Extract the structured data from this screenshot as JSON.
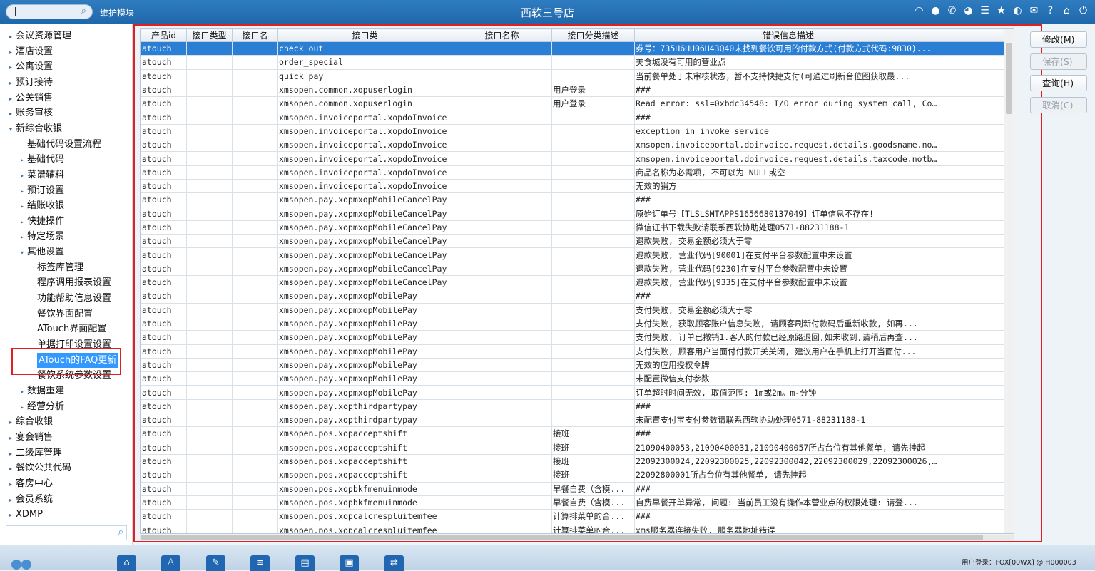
{
  "topbar": {
    "module": "维护模块",
    "title": "西软三号店",
    "icons": [
      "wifi-icon",
      "chat-icon",
      "phone-icon",
      "palette-icon",
      "menu-icon",
      "star-icon",
      "theme-icon",
      "mail-icon",
      "help-icon",
      "home-icon",
      "power-icon"
    ]
  },
  "sidebar": {
    "items": [
      {
        "label": "会议资源管理",
        "level": 0,
        "arrow": "▸"
      },
      {
        "label": "酒店设置",
        "level": 0,
        "arrow": "▸"
      },
      {
        "label": "公寓设置",
        "level": 0,
        "arrow": "▸"
      },
      {
        "label": "预订接待",
        "level": 0,
        "arrow": "▸"
      },
      {
        "label": "公关销售",
        "level": 0,
        "arrow": "▸"
      },
      {
        "label": "账务审核",
        "level": 0,
        "arrow": "▸"
      },
      {
        "label": "新综合收银",
        "level": 0,
        "arrow": "▾"
      },
      {
        "label": "基础代码设置流程",
        "level": 1,
        "arrow": ""
      },
      {
        "label": "基础代码",
        "level": 1,
        "arrow": "▸"
      },
      {
        "label": "菜谱辅料",
        "level": 1,
        "arrow": "▸"
      },
      {
        "label": "预订设置",
        "level": 1,
        "arrow": "▸"
      },
      {
        "label": "结账收银",
        "level": 1,
        "arrow": "▸"
      },
      {
        "label": "快捷操作",
        "level": 1,
        "arrow": "▸"
      },
      {
        "label": "特定场景",
        "level": 1,
        "arrow": "▸"
      },
      {
        "label": "其他设置",
        "level": 1,
        "arrow": "▾"
      },
      {
        "label": "标签库管理",
        "level": 2,
        "arrow": ""
      },
      {
        "label": "程序调用报表设置",
        "level": 2,
        "arrow": ""
      },
      {
        "label": "功能帮助信息设置",
        "level": 2,
        "arrow": ""
      },
      {
        "label": "餐饮界面配置",
        "level": 2,
        "arrow": ""
      },
      {
        "label": "ATouch界面配置",
        "level": 2,
        "arrow": ""
      },
      {
        "label": "单据打印设置设置",
        "level": 2,
        "arrow": ""
      },
      {
        "label": "ATouch的FAQ更新",
        "level": 2,
        "arrow": "",
        "selected": true
      },
      {
        "label": "餐饮系统参数设置",
        "level": 2,
        "arrow": ""
      },
      {
        "label": "数据重建",
        "level": 1,
        "arrow": "▸"
      },
      {
        "label": "经营分析",
        "level": 1,
        "arrow": "▸"
      },
      {
        "label": "综合收银",
        "level": 0,
        "arrow": "▸"
      },
      {
        "label": "宴会销售",
        "level": 0,
        "arrow": "▸"
      },
      {
        "label": "二级库管理",
        "level": 0,
        "arrow": "▸"
      },
      {
        "label": "餐饮公共代码",
        "level": 0,
        "arrow": "▸"
      },
      {
        "label": "客房中心",
        "level": 0,
        "arrow": "▸"
      },
      {
        "label": "会员系统",
        "level": 0,
        "arrow": "▸"
      },
      {
        "label": "XDMP",
        "level": 0,
        "arrow": "▸"
      }
    ],
    "search_placeholder": ""
  },
  "table": {
    "columns": [
      "产品id",
      "接口类型",
      "接口名",
      "接口类",
      "接口名称",
      "接口分类描述",
      "错误信息描述",
      ""
    ],
    "rows": [
      [
        "atouch",
        "",
        "",
        "check_out",
        "",
        "",
        "券号：735H6HU06H43Q40未找到餐饮可用的付款方式(付款方式代码:9830)...",
        ""
      ],
      [
        "atouch",
        "",
        "",
        "order_special",
        "",
        "",
        "美食城没有可用的营业点",
        ""
      ],
      [
        "atouch",
        "",
        "",
        "quick_pay",
        "",
        "",
        "当前餐单处于未审核状态，暂不支持快捷支付(可通过刷新台位图获取最...",
        ""
      ],
      [
        "atouch",
        "",
        "",
        "xmsopen.common.xopuserlogin",
        "",
        "用户登录",
        "###",
        ""
      ],
      [
        "atouch",
        "",
        "",
        "xmsopen.common.xopuserlogin",
        "",
        "用户登录",
        "Read error: ssl=0xbdc34548: I/O error during system call, Connec...",
        ""
      ],
      [
        "atouch",
        "",
        "",
        "xmsopen.invoiceportal.xopdoInvoice",
        "",
        "",
        "###",
        ""
      ],
      [
        "atouch",
        "",
        "",
        "xmsopen.invoiceportal.xopdoInvoice",
        "",
        "",
        "exception in invoke service",
        ""
      ],
      [
        "atouch",
        "",
        "",
        "xmsopen.invoiceportal.xopdoInvoice",
        "",
        "",
        "xmsopen.invoiceportal.doinvoice.request.details.goodsname.notbla...",
        ""
      ],
      [
        "atouch",
        "",
        "",
        "xmsopen.invoiceportal.xopdoInvoice",
        "",
        "",
        "xmsopen.invoiceportal.doinvoice.request.details.taxcode.notblank...",
        ""
      ],
      [
        "atouch",
        "",
        "",
        "xmsopen.invoiceportal.xopdoInvoice",
        "",
        "",
        "商品名称为必需项, 不可以为 NULL或空",
        ""
      ],
      [
        "atouch",
        "",
        "",
        "xmsopen.invoiceportal.xopdoInvoice",
        "",
        "",
        "无效的销方",
        ""
      ],
      [
        "atouch",
        "",
        "",
        "xmsopen.pay.xopmxopMobileCancelPay",
        "",
        "",
        "###",
        ""
      ],
      [
        "atouch",
        "",
        "",
        "xmsopen.pay.xopmxopMobileCancelPay",
        "",
        "",
        "原始订单号【TLSLSMTAPPS1656680137049】订单信息不存在!",
        ""
      ],
      [
        "atouch",
        "",
        "",
        "xmsopen.pay.xopmxopMobileCancelPay",
        "",
        "",
        "微信证书下载失败请联系西软协助处理0571-88231188-1",
        ""
      ],
      [
        "atouch",
        "",
        "",
        "xmsopen.pay.xopmxopMobileCancelPay",
        "",
        "",
        "退款失败, 交易金额必须大于零",
        ""
      ],
      [
        "atouch",
        "",
        "",
        "xmsopen.pay.xopmxopMobileCancelPay",
        "",
        "",
        "退款失败, 营业代码[90001]在支付平台参数配置中未设置",
        ""
      ],
      [
        "atouch",
        "",
        "",
        "xmsopen.pay.xopmxopMobileCancelPay",
        "",
        "",
        "退款失败, 营业代码[9230]在支付平台参数配置中未设置",
        ""
      ],
      [
        "atouch",
        "",
        "",
        "xmsopen.pay.xopmxopMobileCancelPay",
        "",
        "",
        "退款失败, 营业代码[9335]在支付平台参数配置中未设置",
        ""
      ],
      [
        "atouch",
        "",
        "",
        "xmsopen.pay.xopmxopMobilePay",
        "",
        "",
        "###",
        ""
      ],
      [
        "atouch",
        "",
        "",
        "xmsopen.pay.xopmxopMobilePay",
        "",
        "",
        "支付失败, 交易金额必须大于零",
        ""
      ],
      [
        "atouch",
        "",
        "",
        "xmsopen.pay.xopmxopMobilePay",
        "",
        "",
        "支付失败, 获取顾客账户信息失败, 请顾客刷新付款码后重新收款, 如再...",
        ""
      ],
      [
        "atouch",
        "",
        "",
        "xmsopen.pay.xopmxopMobilePay",
        "",
        "",
        "支付失败, 订单已撤销1.客人的付款已经原路退回,如未收到,请稍后再查...",
        ""
      ],
      [
        "atouch",
        "",
        "",
        "xmsopen.pay.xopmxopMobilePay",
        "",
        "",
        "支付失败, 顾客用户当面付付款开关关闭, 建议用户在手机上打开当面付...",
        ""
      ],
      [
        "atouch",
        "",
        "",
        "xmsopen.pay.xopmxopMobilePay",
        "",
        "",
        "无效的应用授权令牌",
        ""
      ],
      [
        "atouch",
        "",
        "",
        "xmsopen.pay.xopmxopMobilePay",
        "",
        "",
        "未配置微信支付参数",
        ""
      ],
      [
        "atouch",
        "",
        "",
        "xmsopen.pay.xopmxopMobilePay",
        "",
        "",
        "订单超时时间无效, 取值范围: 1m或2m。m-分钟",
        ""
      ],
      [
        "atouch",
        "",
        "",
        "xmsopen.pay.xopthirdpartypay",
        "",
        "",
        "###",
        ""
      ],
      [
        "atouch",
        "",
        "",
        "xmsopen.pay.xopthirdpartypay",
        "",
        "",
        "未配置支付宝支付参数请联系西软协助处理0571-88231188-1",
        ""
      ],
      [
        "atouch",
        "",
        "",
        "xmsopen.pos.xopacceptshift",
        "",
        "接班",
        "###",
        ""
      ],
      [
        "atouch",
        "",
        "",
        "xmsopen.pos.xopacceptshift",
        "",
        "接班",
        "21090400053,21090400031,21090400057所占台位有其他餐单, 请先挂起",
        ""
      ],
      [
        "atouch",
        "",
        "",
        "xmsopen.pos.xopacceptshift",
        "",
        "接班",
        "22092300024,22092300025,22092300042,22092300029,22092300026,2209...",
        ""
      ],
      [
        "atouch",
        "",
        "",
        "xmsopen.pos.xopacceptshift",
        "",
        "接班",
        "22092800001所占台位有其他餐单, 请先挂起",
        ""
      ],
      [
        "atouch",
        "",
        "",
        "xmsopen.pos.xopbkfmenuinmode",
        "",
        "早餐自费（含模...",
        "###",
        ""
      ],
      [
        "atouch",
        "",
        "",
        "xmsopen.pos.xopbkfmenuinmode",
        "",
        "早餐自费（含模...",
        "自费早餐开单异常, 问题: 当前员工没有操作本营业点的权限处理: 请登...",
        ""
      ],
      [
        "atouch",
        "",
        "",
        "xmsopen.pos.xopcalcrespluitemfee",
        "",
        "计算排菜单的合...",
        "###",
        ""
      ],
      [
        "atouch",
        "",
        "",
        "xmsopen.pos.xopcalcrespluitemfee",
        "",
        "计算排菜单的合...",
        "xms服务器连接失败, 服务器地址错误",
        ""
      ]
    ],
    "selected_row": 0
  },
  "actions": {
    "buttons": [
      {
        "label": "修改(M)",
        "enabled": true
      },
      {
        "label": "保存(S)",
        "enabled": false
      },
      {
        "label": "查询(H)",
        "enabled": true
      },
      {
        "label": "取消(C)",
        "enabled": false
      }
    ]
  },
  "footer": {
    "buttons": [
      "home-icon",
      "user-key-icon",
      "wrench-icon",
      "list-icon",
      "report-icon",
      "lock-icon",
      "exchange-icon"
    ],
    "user_label": "用户登录：",
    "user_value": "FOX[00WX] @ H000003"
  },
  "colors": {
    "topbar": "#2f7cc0",
    "selection": "#2a7fd4",
    "highlight_box": "#e02020"
  }
}
